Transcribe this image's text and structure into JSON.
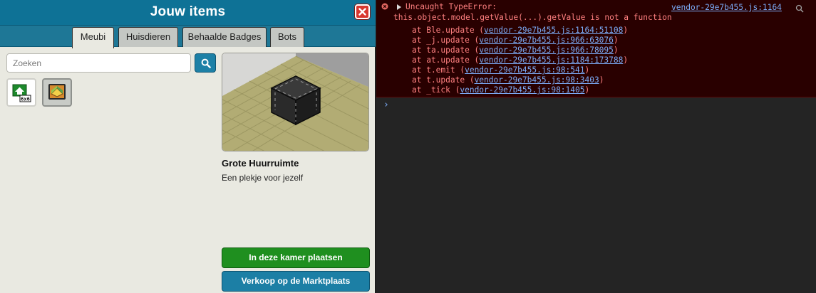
{
  "window": {
    "title": "Jouw items",
    "tabs": [
      {
        "label": "Meubi",
        "active": true
      },
      {
        "label": "Huisdieren",
        "active": false
      },
      {
        "label": "Behaalde Badges",
        "active": false
      },
      {
        "label": "Bots",
        "active": false
      }
    ],
    "search": {
      "placeholder": "Zoeken",
      "value": ""
    },
    "items": [
      {
        "icon": "room-6x6-icon",
        "selected": false
      },
      {
        "icon": "room-floor-icon",
        "selected": true
      }
    ],
    "selected_item": {
      "name": "Grote Huurruimte",
      "description": "Een plekje voor jezelf"
    },
    "buttons": {
      "place": "In deze kamer plaatsen",
      "sell": "Verkoop op de Marktplaats"
    },
    "tile_badge": "6x6"
  },
  "console": {
    "error_line1": "Uncaught TypeError:",
    "error_line2": "this.object.model.getValue(...).getValue is not a function",
    "source_link": "vendor-29e7b455.js:1164",
    "frames": [
      {
        "fn": "at Ble.update (",
        "loc": "vendor-29e7b455.js:1164:51108"
      },
      {
        "fn": "at _j.update (",
        "loc": "vendor-29e7b455.js:966:63076"
      },
      {
        "fn": "at ta.update (",
        "loc": "vendor-29e7b455.js:966:78095"
      },
      {
        "fn": "at at.update (",
        "loc": "vendor-29e7b455.js:1184:173788"
      },
      {
        "fn": "at t.emit (",
        "loc": "vendor-29e7b455.js:98:541"
      },
      {
        "fn": "at t.update (",
        "loc": "vendor-29e7b455.js:98:3403"
      },
      {
        "fn": "at _tick (",
        "loc": "vendor-29e7b455.js:98:1405"
      }
    ],
    "prompt": "›"
  },
  "colors": {
    "titlebar": "#0e7296",
    "window_bg": "#e9e9e1",
    "close": "#d8372e",
    "place_button": "#1f8f1f",
    "sell_button": "#1c7fa5",
    "console_bg": "#242424",
    "error_bg": "#290000",
    "error_text": "#ff8080",
    "link": "#7cacf8"
  }
}
